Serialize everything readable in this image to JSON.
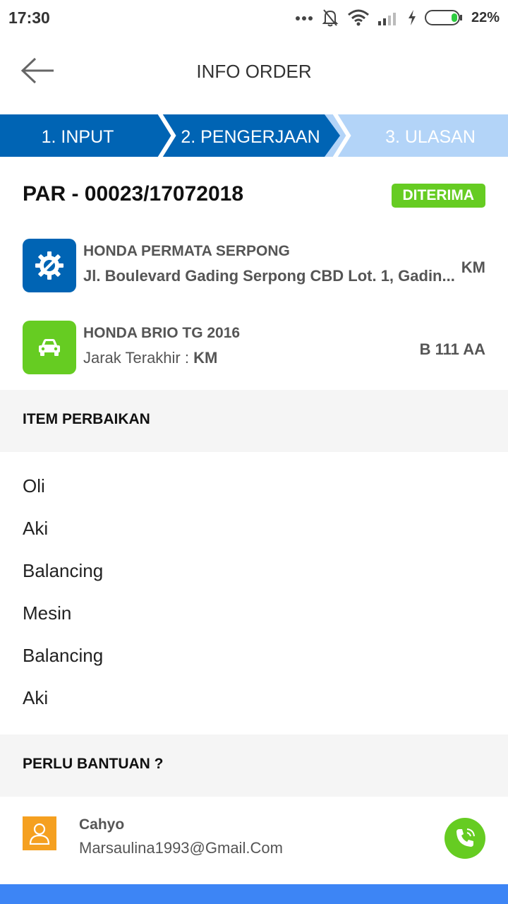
{
  "status_bar": {
    "time": "17:30",
    "battery": "22%",
    "icons": [
      "more-dots-icon",
      "bell-off-icon",
      "wifi-icon",
      "signal-icon",
      "charging-icon",
      "battery-icon"
    ]
  },
  "header": {
    "title": "INFO ORDER",
    "back_icon": "arrow-left-icon"
  },
  "steps": [
    {
      "label": "1. INPUT",
      "state": "done"
    },
    {
      "label": "2. PENGERJAAN",
      "state": "active"
    },
    {
      "label": "3. ULASAN",
      "state": "pending"
    }
  ],
  "order": {
    "number": "PAR - 00023/17072018",
    "status": "DITERIMA"
  },
  "workshop": {
    "icon": "wrench-gear-icon",
    "name": "HONDA PERMATA SERPONG",
    "address": "Jl. Boulevard Gading Serpong CBD Lot. 1, Gadin...",
    "distance": "KM"
  },
  "vehicle": {
    "icon": "car-icon",
    "name": "HONDA BRIO TG 2016",
    "last_distance_label": "Jarak Terakhir : ",
    "last_distance_value": "KM",
    "plate": "B 111 AA"
  },
  "repair_section": {
    "title": "ITEM PERBAIKAN",
    "items": [
      "Oli",
      "Aki",
      "Balancing",
      "Mesin",
      "Balancing",
      "Aki"
    ]
  },
  "help_section": {
    "title": "PERLU BANTUAN ?"
  },
  "contact": {
    "name": "Cahyo",
    "email": "Marsaulina1993@Gmail.Com",
    "call_icon": "phone-icon"
  },
  "colors": {
    "primary": "#0064b4",
    "step_pending": "#b3d4f8",
    "success": "#66cc22",
    "avatar": "#f5a020",
    "bottom_bar": "#3d85f5"
  }
}
